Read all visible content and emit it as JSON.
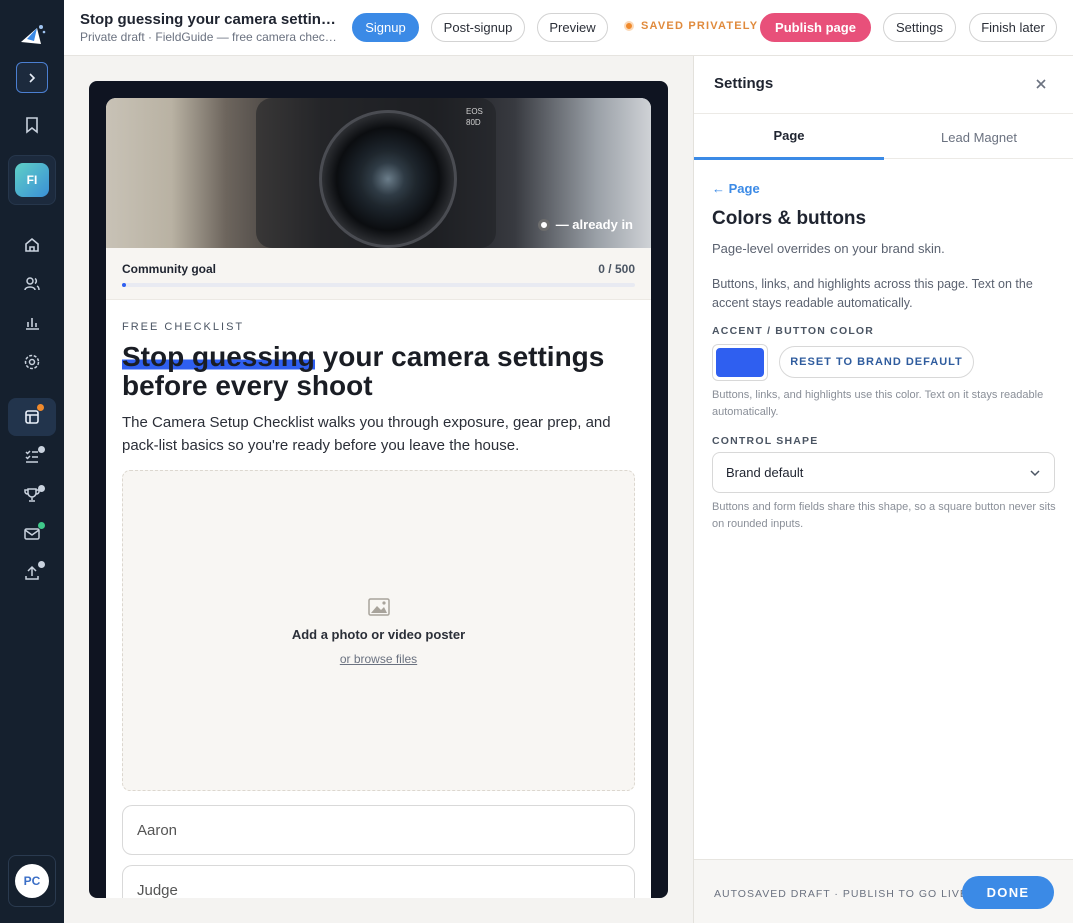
{
  "topbar": {
    "title": "Stop guessing your camera settings before every shoot",
    "subtitle": "Private draft · FieldGuide — free camera checklist",
    "steps": [
      "Signup",
      "Post-signup",
      "Preview"
    ],
    "saved_status": "SAVED PRIVATELY",
    "publish_label": "Publish page",
    "settings_label": "Settings",
    "finish_label": "Finish later"
  },
  "sidebar": {
    "workspace_initials": "FI",
    "user_initials": "PC",
    "icons": [
      "bookmark-icon",
      "home-icon",
      "users-icon",
      "chart-icon",
      "gear-icon",
      "pages-icon",
      "checklist-icon",
      "trophy-icon",
      "mail-icon",
      "upload-icon"
    ]
  },
  "page": {
    "hero_counter_text": "— already in",
    "goal_label": "Community goal",
    "goal_count": "0 / 500",
    "goal_progress": 0,
    "eyebrow": "FREE CHECKLIST",
    "headline_highlight": "Stop guessing",
    "headline_rest": " your camera settings before every shoot",
    "description": "The Camera Setup Checklist walks you through exposure, gear prep, and pack-list basics so you're ready before you leave the house.",
    "media_title": "Add a photo or video poster",
    "media_link": "or browse files",
    "field_first_name": "Aaron",
    "field_last_name": "Judge"
  },
  "panel": {
    "title": "Settings",
    "tabs": [
      "Page",
      "Lead Magnet"
    ],
    "back_label": "← Page",
    "section_title": "Colors & buttons",
    "section_subtitle": "Page-level overrides on your brand skin.",
    "section_description": "Buttons, links, and highlights across this page. Text on the accent stays readable automatically.",
    "accent_label": "ACCENT / BUTTON COLOR",
    "accent_color": "#2f5ff0",
    "reset_label": "RESET TO BRAND DEFAULT",
    "accent_hint": "Buttons, links, and highlights use this color. Text on it stays readable automatically.",
    "shape_label": "CONTROL SHAPE",
    "shape_value": "Brand default",
    "shape_hint": "Buttons and form fields share this shape, so a square button never sits on rounded inputs.",
    "footer_note": "AUTOSAVED DRAFT · PUBLISH TO GO LIVE",
    "done_label": "DONE"
  },
  "colors": {
    "accent": "#2f5ff0",
    "primary_button": "#3b8ae6",
    "publish": "#e8507a",
    "saved": "#e08a3c",
    "rail": "#15202e"
  }
}
